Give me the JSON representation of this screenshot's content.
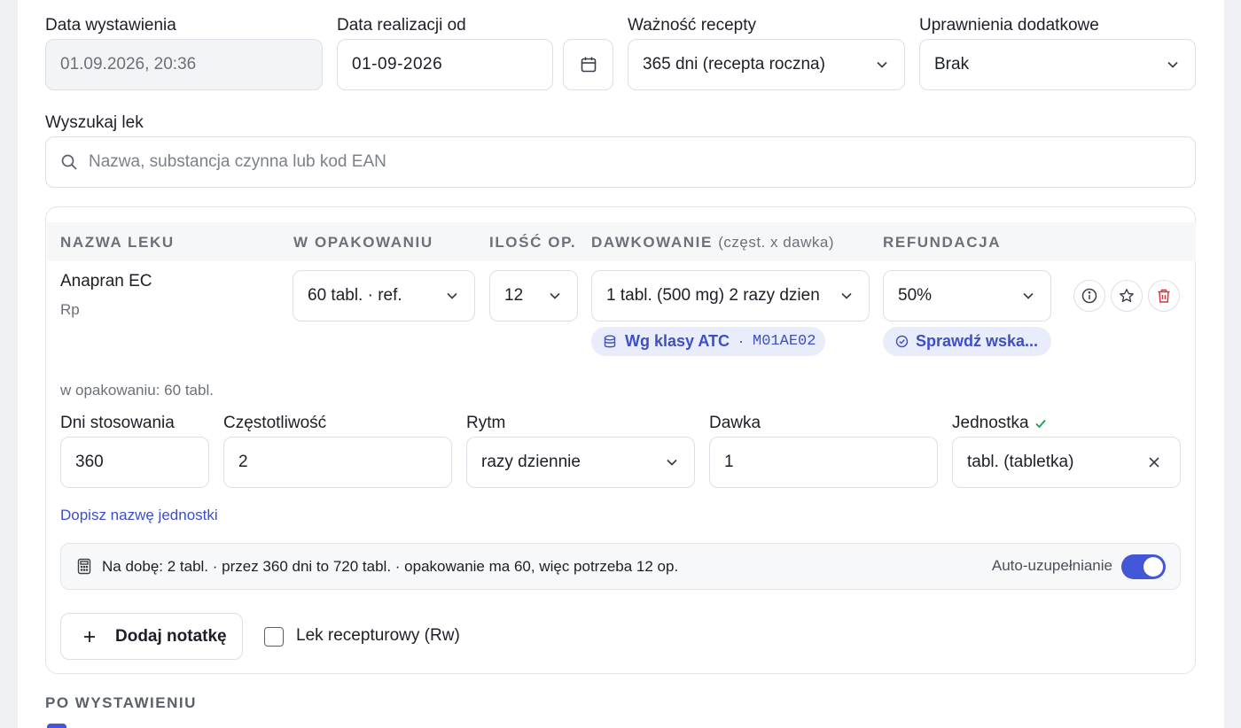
{
  "header_fields": {
    "issue_date": {
      "label": "Data wystawienia",
      "value": "01.09.2026, 20:36"
    },
    "realization_date": {
      "label": "Data realizacji od",
      "value": "01-09-2026"
    },
    "validity": {
      "label": "Ważność recepty",
      "value": "365 dni (recepta roczna)"
    },
    "extra_rights": {
      "label": "Uprawnienia dodatkowe",
      "value": "Brak"
    }
  },
  "search": {
    "label": "Wyszukaj lek",
    "placeholder": "Nazwa, substancja czynna lub kod EAN"
  },
  "table": {
    "headers": {
      "name": "NAZWA LEKU",
      "package": "W OPAKOWANIU",
      "qty": "ILOŚĆ OP.",
      "dosage": "DAWKOWANIE",
      "dosage_hint": "(częst. x dawka)",
      "refund": "REFUNDACJA"
    },
    "row": {
      "drug_name": "Anapran EC",
      "drug_type": "Rp",
      "package": "60 tabl. · ref.",
      "qty": "12",
      "dosage": "1 tabl. (500 mg) 2 razy dzien",
      "atc_label": "Wg klasy ATC",
      "atc_sep": "·",
      "atc_code": "M01AE02",
      "refund": "50%",
      "refund_check": "Sprawdź wska..."
    },
    "package_note": "w opakowaniu: 60 tabl.",
    "details": {
      "days_label": "Dni stosowania",
      "days_value": "360",
      "freq_label": "Częstotliwość",
      "freq_value": "2",
      "rhythm_label": "Rytm",
      "rhythm_value": "razy dziennie",
      "dose_label": "Dawka",
      "dose_value": "1",
      "unit_label": "Jednostka",
      "unit_value": "tabl. (tabletka)"
    },
    "add_unit_link": "Dopisz nazwę jednostki",
    "calc_summary": "Na dobę: 2 tabl. · przez 360 dni to 720 tabl. · opakowanie ma 60, więc potrzeba 12 op.",
    "autofill_label": "Auto-uzupełnianie",
    "autofill_on": true,
    "add_note_button": "Dodaj notatkę",
    "compounded_label": "Lek recepturowy (Rw)"
  },
  "after_issue": {
    "heading": "PO WYSTAWIENIU"
  },
  "colors": {
    "accent": "#4256d8",
    "danger": "#d9363e",
    "success": "#1f9d55",
    "link": "#3d4fc4"
  }
}
